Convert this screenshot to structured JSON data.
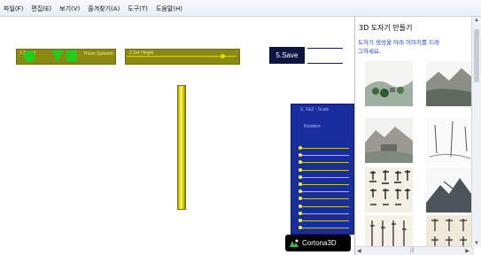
{
  "menu": {
    "items": [
      "파일(F)",
      "편집(E)",
      "보기(V)",
      "즐겨찾기(A)",
      "도구(T)",
      "도움말(H)"
    ]
  },
  "scene": {
    "select_label": "1.Select",
    "shapes_label": "Prism Symetric",
    "height_label": "2.Set Height",
    "save_label": "5.Save",
    "scale_label": "3. X&Z - Scale",
    "rotation_label": "Rotation",
    "player_brand": "Cortona3D"
  },
  "gallery": {
    "title": "3D 도자기 만들기",
    "instructions": "도자기 생성을 아래 이미지를 드래그하세요."
  },
  "colors": {
    "menubar_bg": "#eef2f8",
    "olive_panel": "#8a8a12",
    "shape_green": "#1fcf1f",
    "pillar_yellow": "#e3d400",
    "scale_panel_blue": "#1a2d9e",
    "save_button_navy": "#0f1340",
    "instructions_blue": "#1d3fe6"
  },
  "icons": [
    "circle-shape-icon",
    "triangle-shape-icon",
    "square-shape-icon",
    "cortona3d-logo-icon",
    "scroll-up-icon",
    "scroll-down-icon",
    "scroll-left-icon",
    "scroll-right-icon"
  ]
}
